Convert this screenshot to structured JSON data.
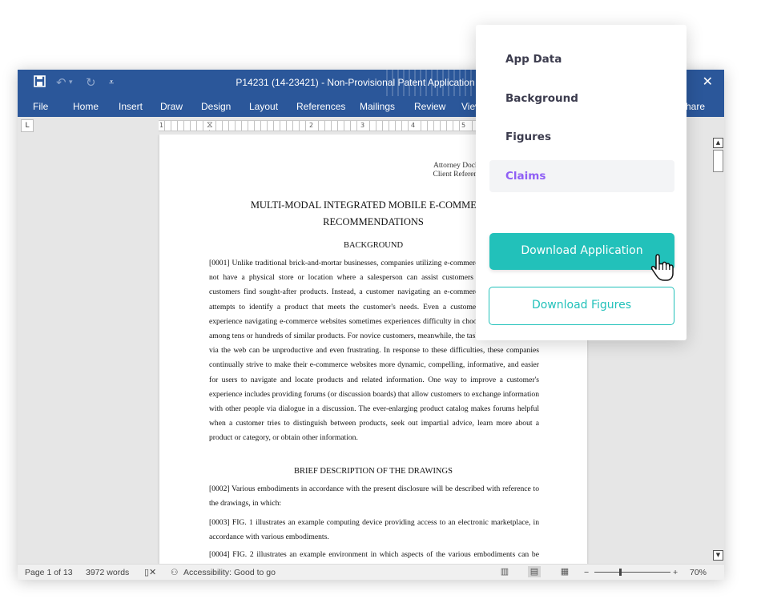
{
  "window": {
    "title": "P14231 (14-23421) - Non-Provisional Patent Application  -  Word",
    "close_glyph": "✕"
  },
  "quick_access": {
    "save_icon": "save-icon",
    "undo_icon": "undo-icon",
    "redo_icon": "redo-icon",
    "customize_icon": "customize-qat-icon"
  },
  "ribbon": {
    "tabs": [
      "File",
      "Home",
      "Insert",
      "Draw",
      "Design",
      "Layout",
      "References",
      "Mailings",
      "Review",
      "View"
    ],
    "share_label": "Share"
  },
  "ruler": {
    "tab_selector": "L",
    "numbers": [
      "1",
      "2",
      "3",
      "4",
      "5"
    ]
  },
  "document": {
    "attorney_line1": "Attorney Docket No.",
    "attorney_line2": "Client Reference No.",
    "title_line1": "MULTI-MODAL INTEGRATED MOBILE E-COMMERCE",
    "title_line2": "RECOMMENDATIONS",
    "background_heading": "BACKGROUND",
    "para_0001": "[0001]    Unlike traditional brick-and-mortar businesses, companies utilizing e-commerce websites often do not have a physical store or location where a salesperson can assist customers and knowledgeable customers find sought-after products. Instead, a customer navigating an e-commerce website typically attempts to identify a product that meets the customer's needs. Even a customer with considerable experience navigating e-commerce websites sometimes experiences difficulty in choosing a product from among tens or hundreds of similar products. For novice customers, meanwhile, the task of shopping online via the web can be unproductive and even frustrating. In response to these difficulties, these companies continually strive to make their e-commerce websites more dynamic, compelling, informative, and easier for users to navigate and locate products and related information. One way to improve a customer's experience includes providing forums (or discussion boards) that allow customers to exchange information with other people via dialogue in a discussion. The ever-enlarging product catalog makes forums helpful when a customer tries to distinguish between products, seek out impartial advice, learn more about a product or category, or obtain other information.",
    "drawings_heading": "BRIEF DESCRIPTION OF THE DRAWINGS",
    "para_0002": "[0002]    Various embodiments in accordance with the present disclosure will be described with reference to the drawings, in which:",
    "para_0003": "[0003]    FIG. 1 illustrates an example computing device providing access to an electronic marketplace, in accordance with various embodiments.",
    "para_0004": "[0004]    FIG. 2 illustrates an example environment in which aspects of the various embodiments can be implemented."
  },
  "status": {
    "page": "Page 1 of 13",
    "words": "3972 words",
    "accessibility": "Accessibility: Good to go",
    "zoom_minus": "−",
    "zoom_plus": "+",
    "zoom": "70%"
  },
  "menu": {
    "items": [
      "App Data",
      "Background",
      "Figures",
      "Claims"
    ],
    "active_item": "Claims",
    "download_application": "Download Application",
    "download_figures": "Download Figures",
    "accent_color": "#22c1ba",
    "active_color": "#8f5ff5"
  },
  "colors": {
    "word_blue": "#2b579a"
  }
}
